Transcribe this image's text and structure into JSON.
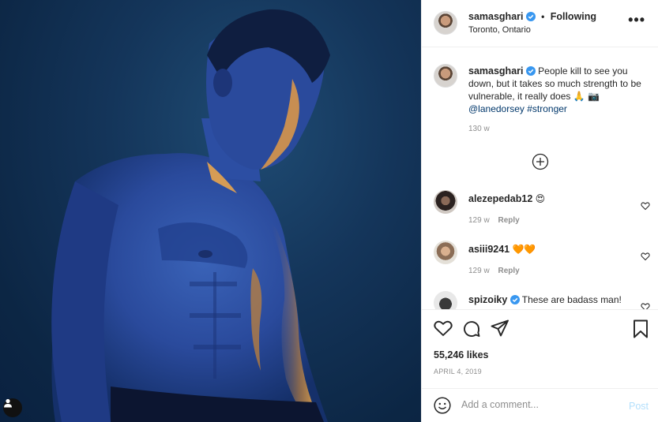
{
  "post": {
    "username": "samasghari",
    "follow_status": "Following",
    "separator": "•",
    "location": "Toronto, Ontario",
    "more_label": "•••",
    "photo_alt": "Shirtless man lit in blue with orange rim light"
  },
  "caption": {
    "username": "samasghari",
    "text": "People kill to see you down, but it takes so much strength to be vulnerable, it really does 🙏 📷",
    "mention": "@lanedorsey",
    "hashtag": "#stronger",
    "time": "130 w"
  },
  "comments": [
    {
      "username": "alezepedab12",
      "text": "😍",
      "time": "129 w",
      "reply": "Reply"
    },
    {
      "username": "asiii9241",
      "text": "🧡🧡",
      "time": "129 w",
      "reply": "Reply"
    },
    {
      "username": "spizoiky",
      "text": "These are badass man!",
      "time": "",
      "reply": ""
    }
  ],
  "stats": {
    "likes": "55,246 likes",
    "date": "APRIL 4, 2019"
  },
  "add_comment": {
    "placeholder": "Add a comment...",
    "post_label": "Post"
  },
  "colors": {
    "verified": "#3897f0",
    "link": "#00376b",
    "muted": "#8e8e8e",
    "post_disabled": "#b2dffc"
  },
  "icons": [
    "verified-badge-icon",
    "more-options-icon",
    "load-more-icon",
    "heart-icon",
    "comment-icon",
    "share-icon",
    "bookmark-icon",
    "emoji-icon",
    "user-tag-icon"
  ]
}
